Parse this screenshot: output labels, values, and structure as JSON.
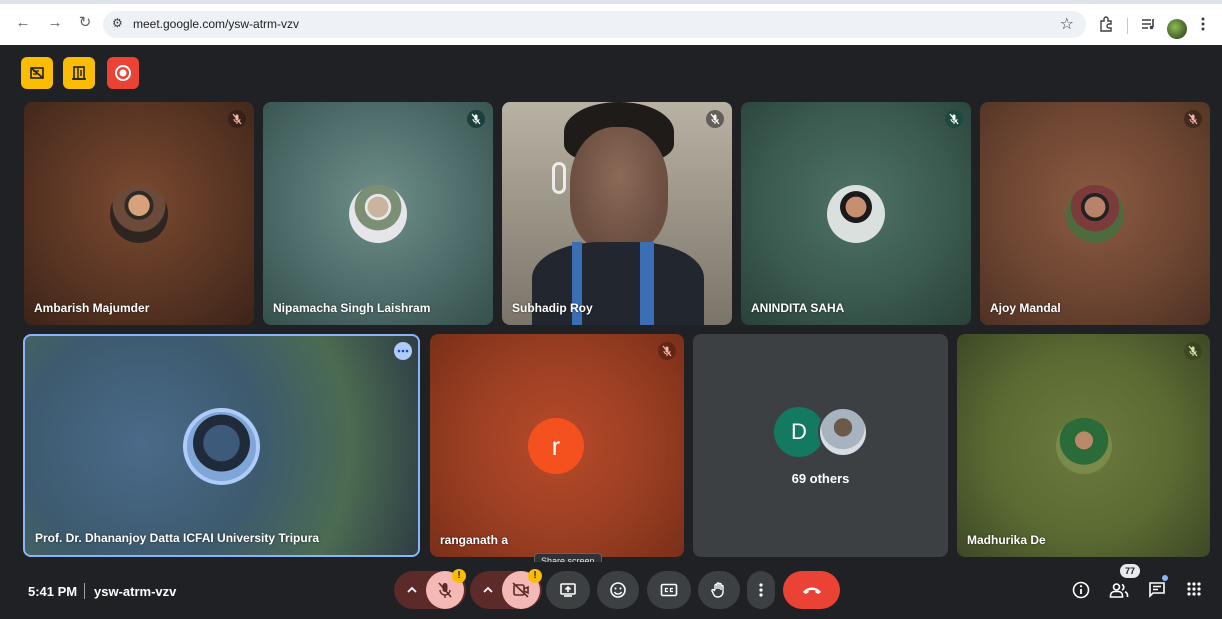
{
  "browser": {
    "url": "meet.google.com/ysw-atrm-vzv"
  },
  "meeting": {
    "time": "5:41 PM",
    "code": "ysw-atrm-vzv"
  },
  "participants": [
    {
      "name": "Ambarish Majumder",
      "mic_muted": true
    },
    {
      "name": "Nipamacha Singh Laishram",
      "mic_muted": true
    },
    {
      "name": "Subhadip Roy",
      "mic_muted": true,
      "video_on": true
    },
    {
      "name": "ANINDITA SAHA",
      "mic_muted": true
    },
    {
      "name": "Ajoy Mandal",
      "mic_muted": true
    },
    {
      "name": "Prof. Dr. Dhananjoy Datta ICFAI University Tripura",
      "speaking": true
    },
    {
      "name": "ranganath a",
      "avatar_letter": "r",
      "mic_muted": true
    },
    {
      "name": "Madhurika De",
      "mic_muted": true
    }
  ],
  "others_tile": {
    "avatar_letter": "D",
    "label": "69 others"
  },
  "controls": {
    "share_tooltip": "Share screen",
    "participants_count": "77"
  },
  "colors": {
    "background": "#202124",
    "hangup": "#ea4335",
    "warning": "#fbbc04",
    "active_speaker_border": "#8ab4f8"
  }
}
